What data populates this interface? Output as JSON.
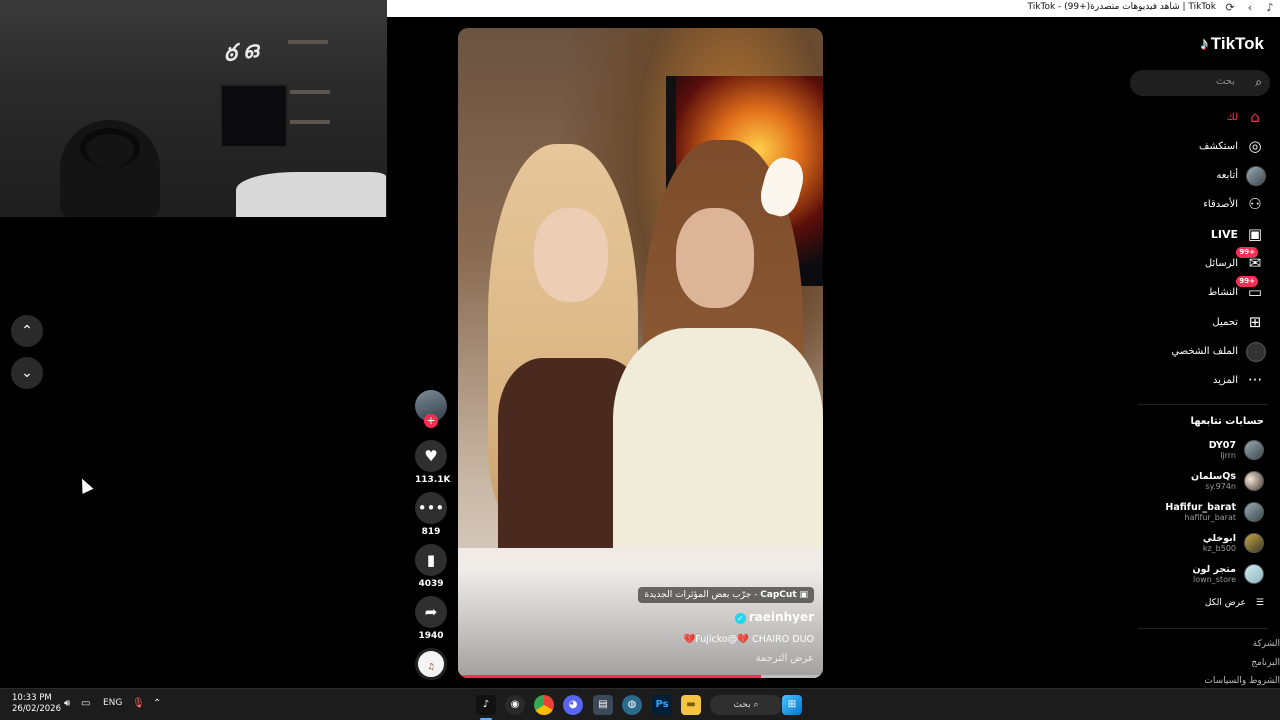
{
  "browser": {
    "title": "TikTok | شاهد فيديوهات متصدرة(+99) - TikTok"
  },
  "feed": {
    "video": {
      "effect_label": "CapCut",
      "effect_text": "جرّب بعض المؤثرات الجديدة",
      "author": "raeinhyer",
      "caption": "💔Fujicko@💔 CHAIRO DUO",
      "translate": "عرض الترجمة",
      "progress": 0.83
    },
    "actions": {
      "likes": "113.1K",
      "comments": "819",
      "saves": "4039",
      "shares": "1940"
    }
  },
  "sidebar": {
    "logo": "TikTok",
    "search_placeholder": "بحث",
    "menu": [
      {
        "label": "لك",
        "icon": "home-icon",
        "active": true
      },
      {
        "label": "استكشف",
        "icon": "compass-icon"
      },
      {
        "label": "أتابعه",
        "icon": "avatar-icon"
      },
      {
        "label": "الأصدقاء",
        "icon": "friends-icon"
      },
      {
        "label": "LIVE",
        "icon": "live-icon"
      },
      {
        "label": "الرسائل",
        "icon": "messages-icon",
        "badge": "99+"
      },
      {
        "label": "النشاط",
        "icon": "activity-icon",
        "badge": "99+"
      },
      {
        "label": "تحميل",
        "icon": "upload-icon"
      },
      {
        "label": "الملف الشخصي",
        "icon": "profile-icon"
      },
      {
        "label": "المزيد",
        "icon": "more-icon"
      }
    ],
    "following_title": "حسابات تتابعها",
    "following": [
      {
        "display": "DY07",
        "user": "ljrrn"
      },
      {
        "display": "سلمانQs",
        "user": "sy.974n"
      },
      {
        "display": "Hafifur_barat",
        "user": "hafifur_barat"
      },
      {
        "display": "ابوخلي",
        "user": "kz_b500"
      },
      {
        "display": "متجر لون",
        "user": "lown_store"
      }
    ],
    "see_all": "عرض الكل",
    "footer": [
      "الشركة",
      "البرنامج",
      "الشروط والسياسات"
    ]
  },
  "taskbar": {
    "time": "10:33 PM",
    "date": "26/02/2026",
    "lang": "ENG",
    "search": "بحث"
  },
  "colors": {
    "accent": "#fe2c55",
    "verified": "#20d5ec",
    "background": "#000000"
  }
}
